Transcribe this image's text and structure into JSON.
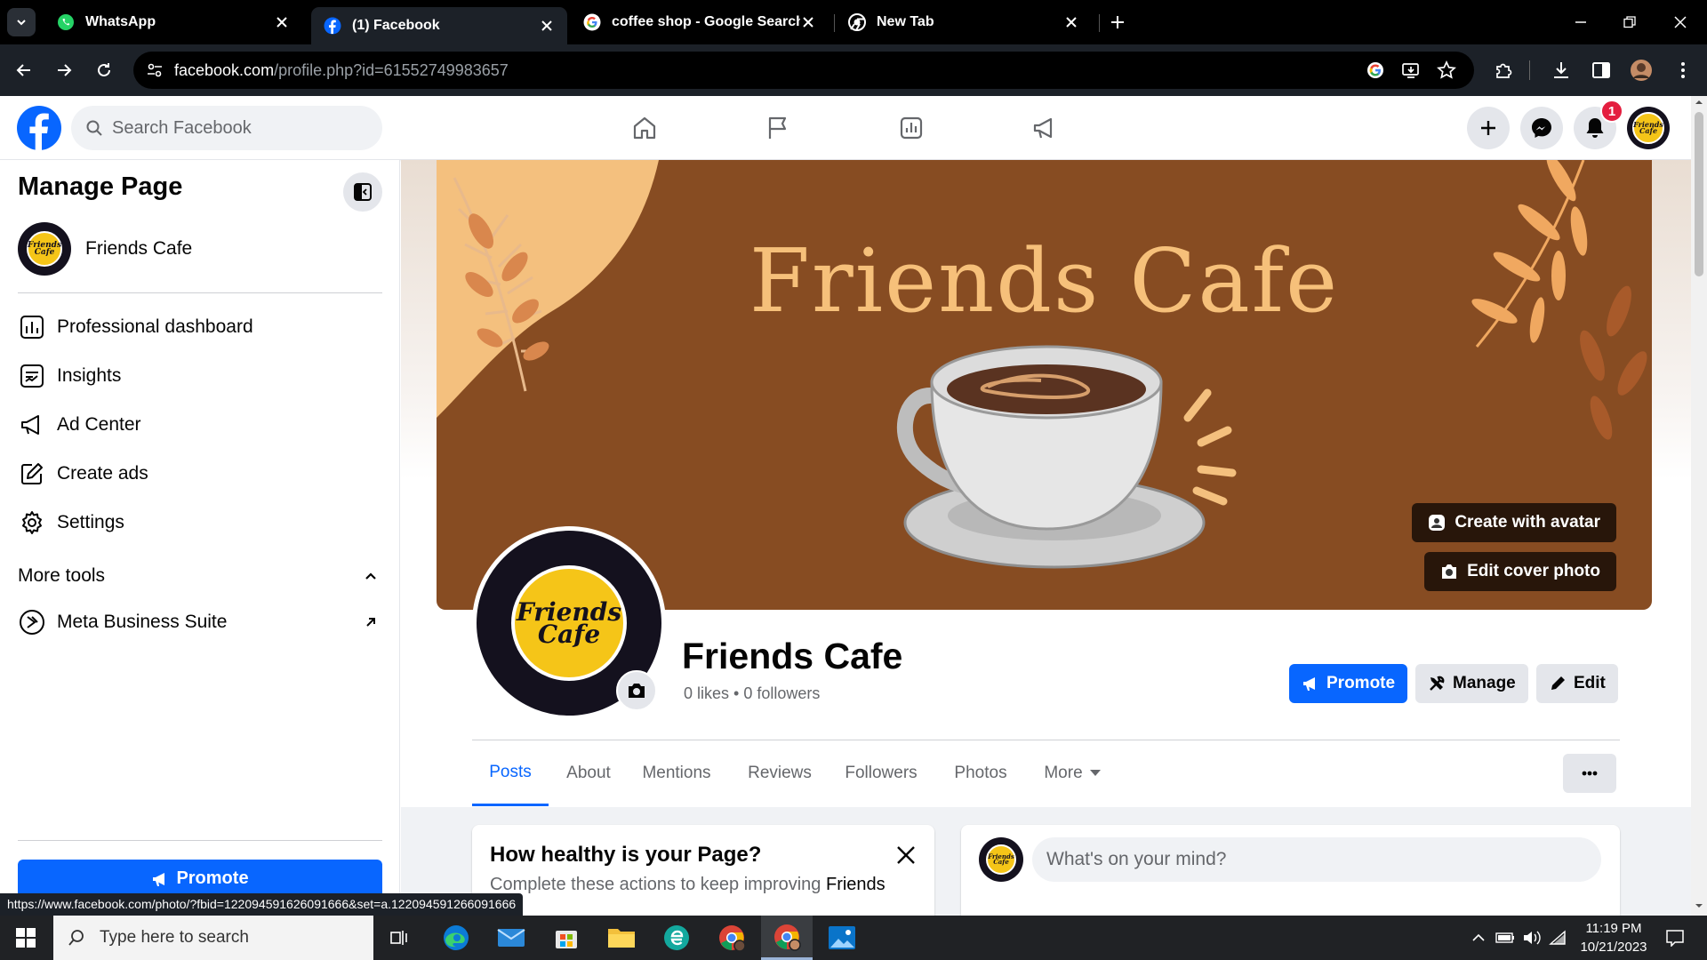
{
  "browser": {
    "tabs": [
      {
        "title": "WhatsApp",
        "icon": "whatsapp-icon"
      },
      {
        "title": "(1) Facebook",
        "icon": "facebook-icon"
      },
      {
        "title": "coffee shop - Google Search",
        "icon": "google-icon"
      },
      {
        "title": "New Tab",
        "icon": "chrome-icon"
      }
    ],
    "url_domain": "facebook.com",
    "url_path": "/profile.php?id=61552749983657",
    "status_url": "https://www.facebook.com/photo/?fbid=122094591626091666&set=a.122094591266091666"
  },
  "facebook": {
    "search_placeholder": "Search Facebook",
    "notification_count": "1",
    "brand_color": "#0866ff"
  },
  "sidebar": {
    "title": "Manage Page",
    "page_name": "Friends Cafe",
    "items": [
      {
        "label": "Professional dashboard",
        "icon": "dashboard-icon"
      },
      {
        "label": "Insights",
        "icon": "insights-icon"
      },
      {
        "label": "Ad Center",
        "icon": "megaphone-icon"
      },
      {
        "label": "Create ads",
        "icon": "edit-icon"
      },
      {
        "label": "Settings",
        "icon": "gear-icon"
      }
    ],
    "more_tools_label": "More tools",
    "meta_business_label": "Meta Business Suite",
    "promote_label": "Promote"
  },
  "profile": {
    "cover_title": "Friends Cafe",
    "logo_line1": "Friends",
    "logo_line2": "Cafe",
    "name": "Friends Cafe",
    "stats": "0 likes • 0 followers",
    "create_avatar_label": "Create with avatar",
    "edit_cover_label": "Edit cover photo",
    "promote_label": "Promote",
    "manage_label": "Manage",
    "edit_label": "Edit",
    "tabs": [
      "Posts",
      "About",
      "Mentions",
      "Reviews",
      "Followers",
      "Photos",
      "More"
    ],
    "active_tab": "Posts"
  },
  "health_card": {
    "title": "How healthy is your Page?",
    "subtitle_prefix": "Complete these actions to keep improving ",
    "subtitle_bold": "Friends"
  },
  "composer": {
    "placeholder": "What's on your mind?"
  },
  "taskbar": {
    "search_placeholder": "Type here to search",
    "time": "11:19 PM",
    "date": "10/21/2023"
  }
}
